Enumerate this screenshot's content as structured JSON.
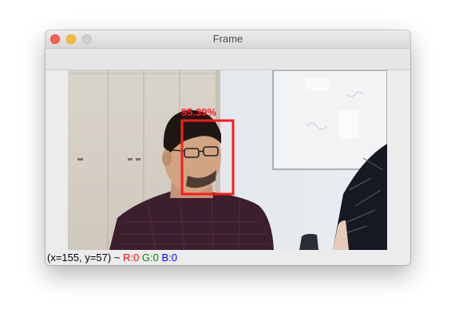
{
  "window": {
    "title": "Frame"
  },
  "detection": {
    "confidence_label": "95.39%",
    "box_color": "#ff1a1a"
  },
  "status": {
    "coords": "(x=155, y=57) ~ ",
    "r": "R:0",
    "g": "G:0",
    "b": "B:0"
  }
}
